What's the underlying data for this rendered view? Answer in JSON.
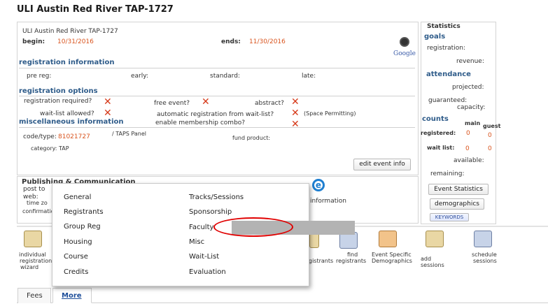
{
  "page": {
    "title": "ULI Austin Red River TAP-1727"
  },
  "event": {
    "name": "ULI Austin Red River TAP-1727",
    "begin_label": "begin:",
    "begin": "10/31/2016",
    "ends_label": "ends:",
    "ends": "11/30/2016",
    "google_logo": "Google"
  },
  "registration_info": {
    "heading": "registration information",
    "pre_reg": "pre reg:",
    "early": "early:",
    "standard": "standard:",
    "late": "late:"
  },
  "registration_options": {
    "heading": "registration options",
    "required": "registration required?",
    "free": "free event?",
    "abstract": "abstract?",
    "waitlist": "wait-list allowed?",
    "auto_reg": "automatic registration from wait-list?",
    "space": "(Space Permitting)",
    "membership": "enable membership combo?"
  },
  "misc": {
    "heading": "miscellaneous information",
    "code_label": "code/type:",
    "code": "81021727",
    "type": "/ TAPS Panel",
    "fund_product": "fund product:",
    "category": "category:  TAP",
    "edit_button": "edit event info"
  },
  "publishing": {
    "heading": "Publishing & Communication",
    "post_to": "post to",
    "web": "web:",
    "time_zone": "time zo",
    "confirmation": "confirmatio",
    "information": "information"
  },
  "statistics": {
    "title": "Statistics",
    "goals": "goals",
    "registration": "registration:",
    "revenue": "revenue:",
    "attendance": "attendance",
    "projected": "projected:",
    "guaranteed": "guaranteed:",
    "capacity": "capacity:",
    "counts": "counts",
    "main": "main",
    "guest": "guest",
    "registered": "registered:",
    "registered_main": "0",
    "registered_guest": "0",
    "waitlist": "wait list:",
    "waitlist_main": "0",
    "waitlist_guest": "0",
    "available": "available:",
    "remaining": "remaining:",
    "event_stats_button": "Event Statistics",
    "demographics_button": "demographics",
    "keywords_button": "KEYWORDS"
  },
  "toolbar": {
    "individual": "individual",
    "registration": "registration",
    "wizard": "wizard",
    "find_registrants": "find",
    "registrants_left": "gistrants",
    "registrants_find": "registrants",
    "event_specific": "Event Specific",
    "demographics": "Demographics",
    "add": "add",
    "sessions": "sessions",
    "schedule": "schedule",
    "schedule_sessions": "sessions"
  },
  "menu": {
    "left": [
      "General",
      "Registrants",
      "Group Reg",
      "Housing",
      "Course",
      "Credits"
    ],
    "right": [
      "Tracks/Sessions",
      "Sponsorship",
      "Faculty",
      "Misc",
      "Wait-List",
      "Evaluation"
    ]
  },
  "tabs": {
    "fees": "Fees",
    "more": "More"
  }
}
